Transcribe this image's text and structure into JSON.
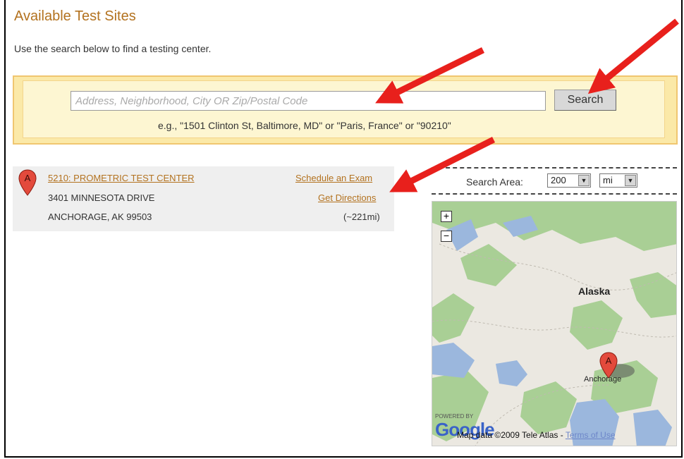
{
  "page": {
    "title": "Available Test Sites",
    "intro": "Use the search below to find a testing center."
  },
  "search": {
    "placeholder": "Address, Neighborhood, City OR Zip/Postal Code",
    "button_label": "Search",
    "example": "e.g., \"1501 Clinton St, Baltimore, MD\" or \"Paris, France\" or \"90210\""
  },
  "results": [
    {
      "marker": "A",
      "name": "5210: PROMETRIC TEST CENTER",
      "address_line1": "3401 MINNESOTA DRIVE",
      "address_line2": "ANCHORAGE, AK 99503",
      "schedule_label": "Schedule an Exam",
      "directions_label": "Get Directions",
      "distance": "(~221mi)"
    }
  ],
  "search_area": {
    "label": "Search Area:",
    "radius_value": "200",
    "unit_value": "mi"
  },
  "map": {
    "zoom_in": "+",
    "zoom_out": "−",
    "region_label": "Alaska",
    "city_label": "Anchorage",
    "marker": "A",
    "powered_by": "POWERED BY",
    "logo": "Google",
    "data_credit": "Map data ©2009 Tele Atlas - ",
    "terms_label": "Terms of Use"
  },
  "colors": {
    "link": "#b3721f",
    "search_band": "#fbe9a8",
    "arrow": "#e8201c",
    "marker": "#e34a3c"
  }
}
